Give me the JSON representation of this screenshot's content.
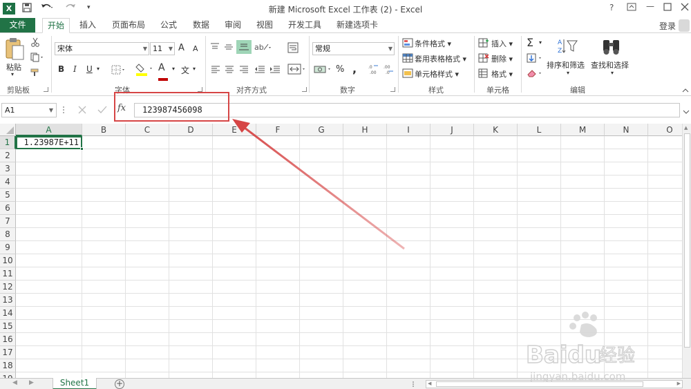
{
  "window": {
    "title": "新建 Microsoft Excel 工作表 (2) - Excel",
    "help": "?",
    "controls": [
      "restore",
      "minimize",
      "maximize",
      "close"
    ]
  },
  "quick_access": {
    "logo": "X",
    "icons": [
      "save-icon",
      "undo-icon",
      "redo-icon",
      "customize-icon"
    ]
  },
  "tabs": [
    {
      "label": "文件"
    },
    {
      "label": "开始"
    },
    {
      "label": "插入"
    },
    {
      "label": "页面布局"
    },
    {
      "label": "公式"
    },
    {
      "label": "数据"
    },
    {
      "label": "审阅"
    },
    {
      "label": "视图"
    },
    {
      "label": "开发工具"
    },
    {
      "label": "新建选项卡"
    }
  ],
  "login_label": "登录",
  "ribbon": {
    "clipboard": {
      "paste": "粘贴",
      "label": "剪贴板"
    },
    "font": {
      "font_name": "宋体",
      "font_size": "11",
      "bold": "B",
      "italic": "I",
      "underline": "U",
      "grow": "A",
      "shrink": "A",
      "wen": "文",
      "label": "字体"
    },
    "alignment": {
      "label": "对齐方式"
    },
    "number": {
      "format": "常规",
      "percent": "%",
      "comma": ",",
      "label": "数字"
    },
    "styles": {
      "conditional": "条件格式",
      "table_format": "套用表格格式",
      "cell_styles": "单元格样式",
      "label": "样式"
    },
    "cells": {
      "insert": "插入",
      "delete": "删除",
      "format": "格式",
      "label": "单元格"
    },
    "editing": {
      "sigma": "Σ",
      "sort_filter": "排序和筛选",
      "find_select": "查找和选择",
      "label": "编辑"
    }
  },
  "formula_bar": {
    "name_box": "A1",
    "fx": "fx",
    "value": "123987456098"
  },
  "grid": {
    "columns": [
      "A",
      "B",
      "C",
      "D",
      "E",
      "F",
      "G",
      "H",
      "I",
      "J",
      "K",
      "L",
      "M",
      "N",
      "O"
    ],
    "rows": [
      "1",
      "2",
      "3",
      "4",
      "5",
      "6",
      "7",
      "8",
      "9",
      "10",
      "11",
      "12",
      "13",
      "14",
      "15",
      "16",
      "17",
      "18",
      "19"
    ],
    "active_cell_value": "1.23987E+11"
  },
  "sheet": {
    "tab": "Sheet1",
    "add": "+"
  },
  "colors": {
    "excel_green": "#217346",
    "annotation_red": "#d64545"
  }
}
